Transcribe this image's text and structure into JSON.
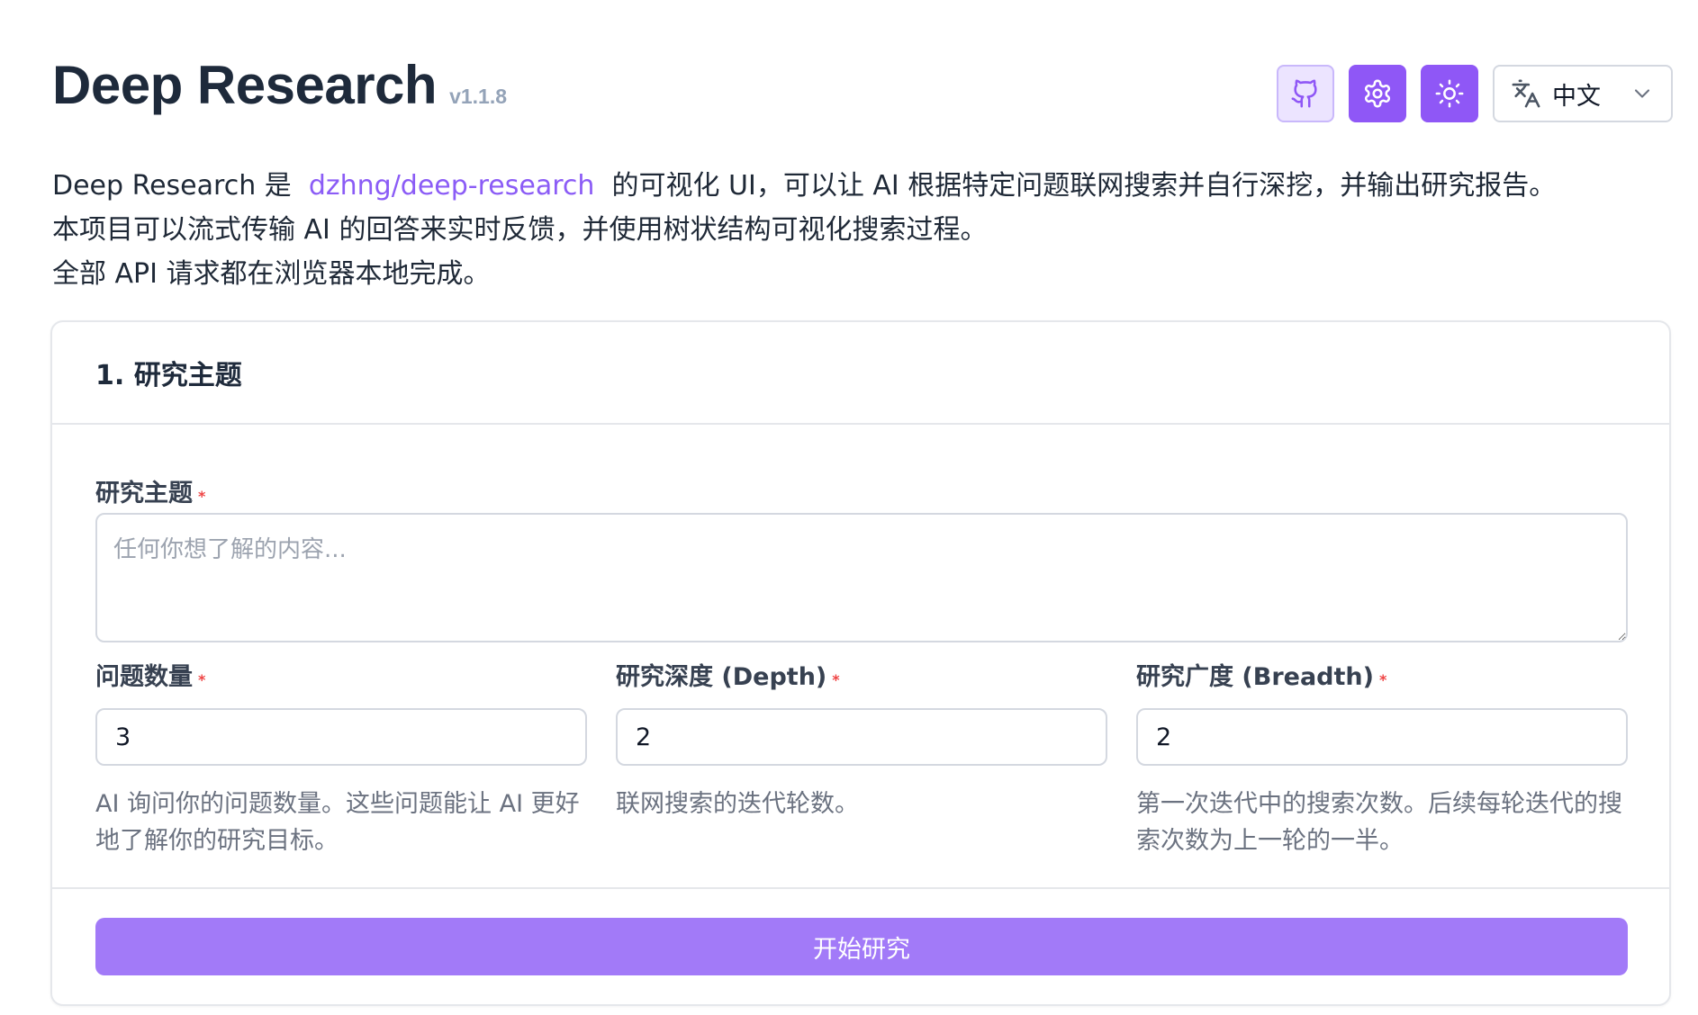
{
  "app": {
    "title": "Deep Research",
    "version": "v1.1.8"
  },
  "toolbar": {
    "github_icon": "github-icon",
    "settings_icon": "gear-icon",
    "theme_icon": "sun-icon",
    "language": "中文"
  },
  "intro": {
    "line1_prefix": "Deep Research 是",
    "line1_link": "dzhng/deep-research",
    "line1_suffix": "的可视化 UI，可以让 AI 根据特定问题联网搜索并自行深挖，并输出研究报告。",
    "line2": "本项目可以流式传输 AI 的回答来实时反馈，并使用树状结构可视化搜索过程。",
    "line3": "全部 API 请求都在浏览器本地完成。"
  },
  "card": {
    "title": "1. 研究主题",
    "topic": {
      "label": "研究主题",
      "required": "*",
      "placeholder": "任何你想了解的内容...",
      "value": ""
    },
    "fields": [
      {
        "label": "问题数量",
        "required": "*",
        "value": "3",
        "hint": "AI 询问你的问题数量。这些问题能让 AI 更好地了解你的研究目标。"
      },
      {
        "label": "研究深度 (Depth)",
        "required": "*",
        "value": "2",
        "hint": "联网搜索的迭代轮数。"
      },
      {
        "label": "研究广度 (Breadth)",
        "required": "*",
        "value": "2",
        "hint": "第一次迭代中的搜索次数。后续每轮迭代的搜索次数为上一轮的一半。"
      }
    ],
    "start_button": "开始研究"
  },
  "colors": {
    "accent": "#8f57f6",
    "accent_light": "#a27af8",
    "link": "#8b5cf6",
    "required": "#ef4444"
  }
}
